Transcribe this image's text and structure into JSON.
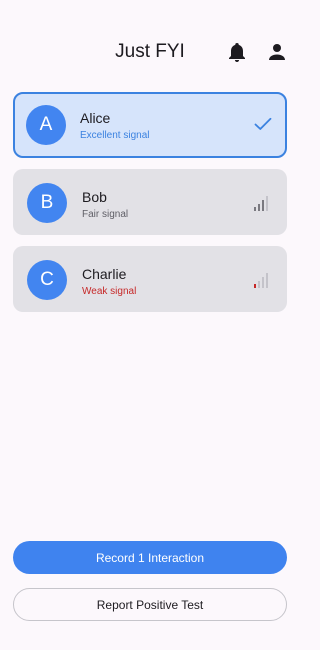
{
  "header": {
    "title": "Just FYI",
    "bell_icon": "notifications-icon",
    "person_icon": "person-icon"
  },
  "contacts": [
    {
      "initial": "A",
      "name": "Alice",
      "signal_label": "Excellent signal",
      "signal_level": "excellent",
      "selected": true,
      "label_color": "#3b82e0"
    },
    {
      "initial": "B",
      "name": "Bob",
      "signal_label": "Fair signal",
      "signal_level": "fair",
      "selected": false,
      "label_color": "#5f5e66"
    },
    {
      "initial": "C",
      "name": "Charlie",
      "signal_label": "Weak signal",
      "signal_level": "weak",
      "selected": false,
      "label_color": "#c62828"
    }
  ],
  "actions": {
    "primary_label": "Record 1 Interaction",
    "secondary_label": "Report Positive Test"
  },
  "colors": {
    "accent": "#3f83ef",
    "selected_bg": "#d6e4fb",
    "card_bg": "#e2e1e6",
    "weak": "#c62828"
  }
}
